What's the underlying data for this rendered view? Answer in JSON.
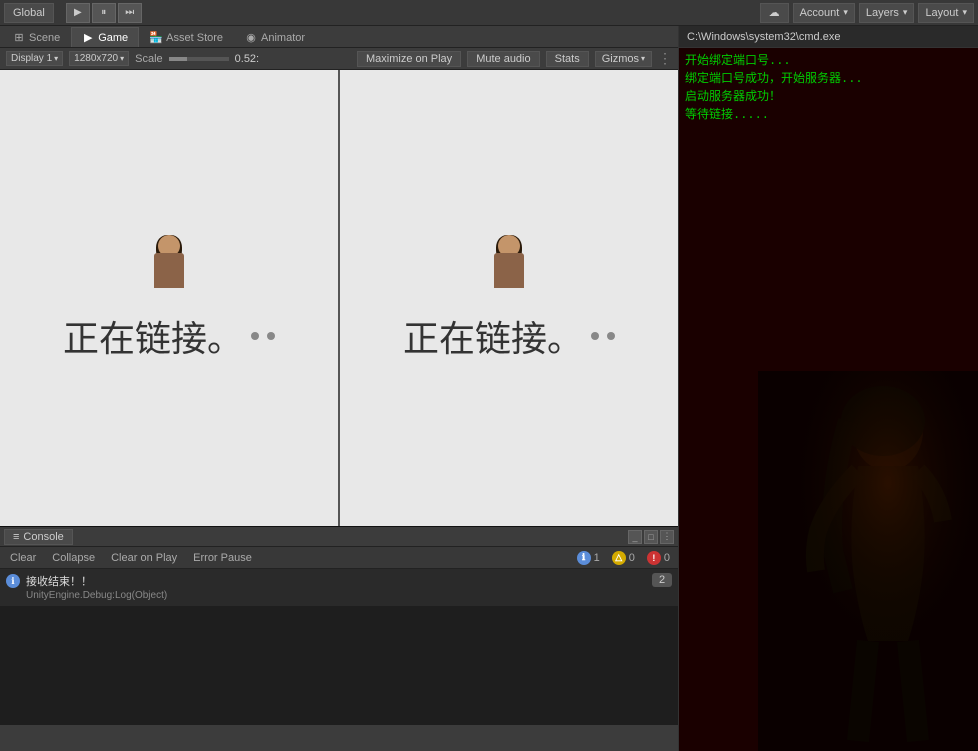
{
  "topbar": {
    "global_label": "Global",
    "play_icon": "▶",
    "pause_icon": "⏸",
    "step_icon": "⏭",
    "cloud_icon": "☁",
    "account_label": "Account",
    "layers_label": "Layers",
    "layout_label": "Layout"
  },
  "tabs": [
    {
      "id": "scene",
      "label": "Scene",
      "icon": "⊞",
      "active": false
    },
    {
      "id": "game",
      "label": "Game",
      "icon": "🎮",
      "active": true
    },
    {
      "id": "asset-store",
      "label": "Asset Store",
      "icon": "🏪",
      "active": false
    },
    {
      "id": "animator",
      "label": "Animator",
      "icon": "◉",
      "active": false
    }
  ],
  "game_controls": {
    "display_label": "Display 1",
    "resolution_label": "1280x720",
    "scale_label": "Scale",
    "scale_value": "0.52:",
    "maximize_label": "Maximize on Play",
    "mute_label": "Mute audio",
    "stats_label": "Stats",
    "gizmos_label": "Gizmos"
  },
  "viewport": {
    "left_panel": {
      "connecting_text": "正在链接。",
      "dots": 2
    },
    "right_panel": {
      "connecting_text": "正在链接。",
      "dots": 2
    }
  },
  "console": {
    "title": "Console",
    "buttons": {
      "clear": "Clear",
      "collapse": "Collapse",
      "clear_on_play": "Clear on Play",
      "error_pause": "Error Pause"
    },
    "counts": {
      "info": "1",
      "warn": "0",
      "error": "0"
    },
    "log_items": [
      {
        "line1": "接收结束！！",
        "line2": "UnityEngine.Debug:Log(Object)",
        "count": "2"
      }
    ]
  },
  "terminal": {
    "title": "C:\\Windows\\system32\\cmd.exe",
    "lines": [
      "开始绑定端口号...",
      "绑定端口号成功，开始服务器...",
      "启动服务器成功！",
      "等待链接....."
    ]
  }
}
